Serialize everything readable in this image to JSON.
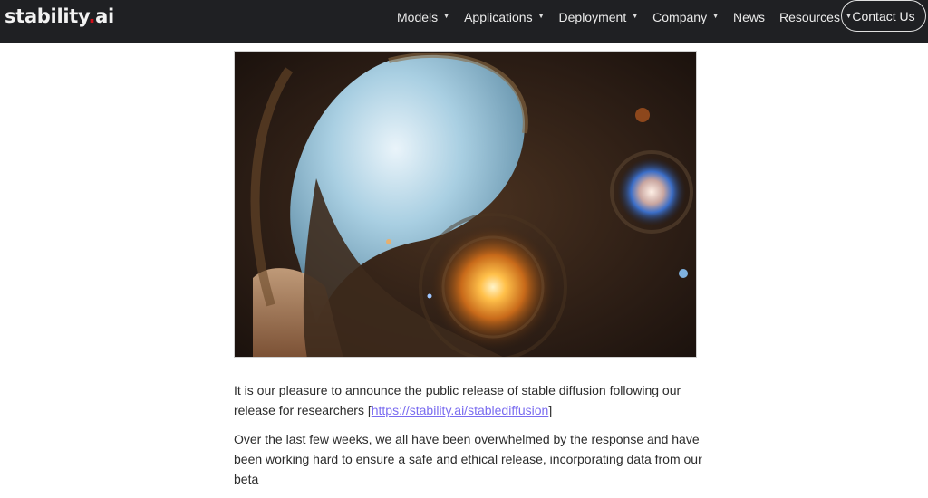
{
  "nav": {
    "logo": {
      "text_main": "stability",
      "text_dot": ".",
      "text_suffix": "ai"
    },
    "items": [
      {
        "label": "Models",
        "dropdown": true
      },
      {
        "label": "Applications",
        "dropdown": true
      },
      {
        "label": "Deployment",
        "dropdown": true
      },
      {
        "label": "Company",
        "dropdown": true
      },
      {
        "label": "News",
        "dropdown": false
      },
      {
        "label": "Resources",
        "dropdown": true
      }
    ],
    "caret": "▼",
    "contact_label": "Contact Us",
    "accent_dot_color": "#d0101a"
  },
  "hero": {
    "alt": "fantasy sci-fi artwork of ornate portal with glowing orb"
  },
  "article": {
    "p1_text": "It is our pleasure to announce the public release of stable diffusion following our release for researchers [",
    "p1_link": "https://stability.ai/stablediffusion",
    "p1_end": "]",
    "p2_text": "Over the last few weeks, we all have been overwhelmed by the response and have been working hard to ensure a safe and ethical release, incorporating data from our beta"
  }
}
